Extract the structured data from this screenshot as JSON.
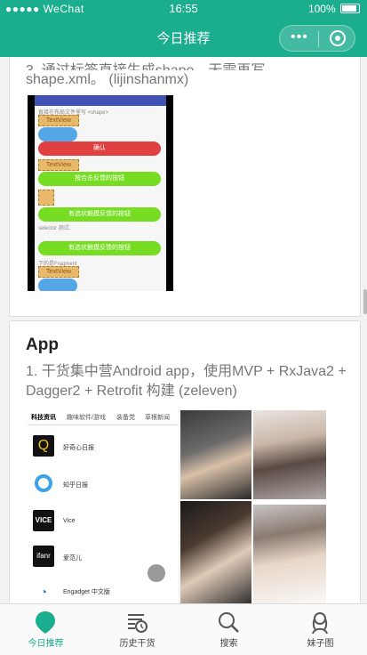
{
  "status_bar": {
    "signal": "●●●●● WeChat",
    "time": "16:55",
    "battery": "100%"
  },
  "nav": {
    "title": "今日推荐"
  },
  "card1": {
    "partial_text": "3. 通过标签直接生成shape，无需再写",
    "text": "shape.xml。 (lijinshanmx)",
    "screenshot": {
      "header": "直接在布局文件里写 <shape>",
      "items": [
        "TextView",
        "TextView",
        "确认",
        "TextView",
        "按合击反馈的按钮",
        "有选状触摸反馈的按钮",
        "selector 测试:",
        "有选状触摸反馈的按钮",
        "下的是Fragment",
        "TextView"
      ]
    }
  },
  "card2": {
    "title": "App",
    "text": "1. 干货集中营Android app，使用MVP + RxJava2 + Dagger2 + Retrofit 构建 (zeleven)",
    "tabs": [
      "科技资讯",
      "趣味软件/游戏",
      "装备党",
      "草根新闻"
    ],
    "apps": [
      "好奇心日报",
      "知乎日报",
      "Vice",
      "爱范儿",
      "Engadget 中文版"
    ],
    "logos": [
      "Q",
      "VICE",
      "ifanr"
    ]
  },
  "tabbar": [
    {
      "label": "今日推荐",
      "icon": "drop-pin-icon",
      "active": true
    },
    {
      "label": "历史干货",
      "icon": "history-list-icon",
      "active": false
    },
    {
      "label": "搜索",
      "icon": "search-icon",
      "active": false
    },
    {
      "label": "妹子图",
      "icon": "girl-icon",
      "active": false
    }
  ],
  "colors": {
    "brand": "#1aad8e",
    "active": "#1aad8e"
  }
}
